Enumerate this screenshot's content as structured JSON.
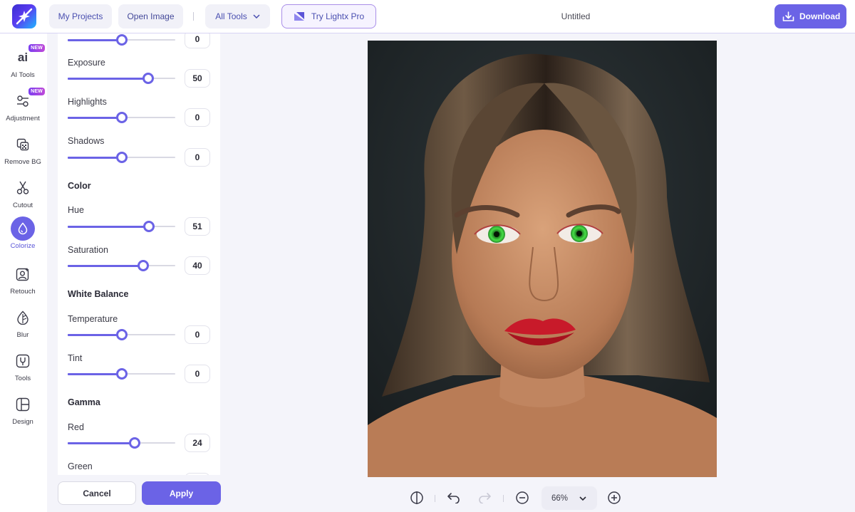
{
  "header": {
    "my_projects": "My Projects",
    "open_image": "Open Image",
    "all_tools": "All Tools",
    "try_pro": "Try Lightx Pro",
    "doc_title": "Untitled",
    "download": "Download"
  },
  "sidebar": {
    "items": [
      {
        "label": "AI Tools",
        "icon": "ai-icon",
        "badge": "NEW"
      },
      {
        "label": "Adjustment",
        "icon": "sliders-icon",
        "badge": "NEW"
      },
      {
        "label": "Remove BG",
        "icon": "remove-bg-icon"
      },
      {
        "label": "Cutout",
        "icon": "scissors-icon"
      },
      {
        "label": "Colorize",
        "icon": "droplet-icon",
        "active": true
      },
      {
        "label": "Retouch",
        "icon": "retouch-icon"
      },
      {
        "label": "Blur",
        "icon": "blur-icon"
      },
      {
        "label": "Tools",
        "icon": "tools-icon"
      },
      {
        "label": "Design",
        "icon": "design-icon"
      }
    ]
  },
  "panel": {
    "top_partial_value": "0",
    "exposure": {
      "label": "Exposure",
      "value": "50"
    },
    "highlights": {
      "label": "Highlights",
      "value": "0"
    },
    "shadows": {
      "label": "Shadows",
      "value": "0"
    },
    "color_section": "Color",
    "hue": {
      "label": "Hue",
      "value": "51"
    },
    "saturation": {
      "label": "Saturation",
      "value": "40"
    },
    "white_balance_section": "White Balance",
    "temperature": {
      "label": "Temperature",
      "value": "0"
    },
    "tint": {
      "label": "Tint",
      "value": "0"
    },
    "gamma_section": "Gamma",
    "red": {
      "label": "Red",
      "value": "24"
    },
    "green": {
      "label": "Green"
    },
    "slider_levels": {
      "top_partial": 0.5,
      "exposure": 0.75,
      "highlights": 0.5,
      "shadows": 0.5,
      "hue": 0.755,
      "saturation": 0.7,
      "temperature": 0.5,
      "tint": 0.5,
      "red": 0.62
    },
    "cancel": "Cancel",
    "apply": "Apply"
  },
  "bottom_bar": {
    "zoom": "66%"
  },
  "colors": {
    "accent": "#6b63e6",
    "panel_bg": "#ffffff",
    "canvas_bg": "#f4f4fa"
  }
}
